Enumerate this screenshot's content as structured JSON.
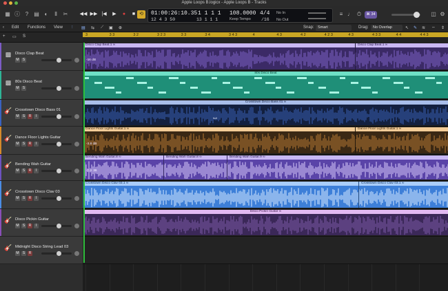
{
  "window": {
    "title": "Apple Loops B.logicx - Apple Loops B - Tracks"
  },
  "lcd": {
    "time": "01:00:26:10.35",
    "position": "12  4  3  50",
    "bars": "1  1  1  1",
    "bars2": "13  1  1  1",
    "tempo": "108.0000",
    "tempo_mode": "Keep Tempo",
    "signature": "4/4",
    "division": "/16",
    "midi_in": "No In",
    "midi_out": "No Out"
  },
  "badge": "⌘ 34",
  "toolbar": {
    "edit": "Edit",
    "functions": "Functions",
    "view": "View",
    "snap_label": "Snap:",
    "snap_value": "Smart",
    "drag_label": "Drag:",
    "drag_value": "No Overlap"
  },
  "ruler": {
    "numbers": [
      "3",
      "3 3",
      "3 2",
      "3 2 3",
      "3 3",
      "3 4",
      "3 4 3",
      "4",
      "4 3",
      "4 2",
      "4 2 3",
      "4 3",
      "4 3 3",
      "4 4",
      "4 4 3"
    ]
  },
  "tracks": [
    {
      "name": "Disco Clap Beat",
      "color": "#7d5cc6",
      "buttons": [
        "M",
        "S"
      ],
      "region_title": "Disco Clap Beat.1",
      "region_title_2": "Disco Clap Beat.1",
      "label": "-16 dB"
    },
    {
      "name": "80s Disco Beat",
      "color": "#2fb596",
      "buttons": [
        "M",
        "S"
      ],
      "region_title": "80s Disco Beat"
    },
    {
      "name": "Crosstown Disco Bass 01",
      "color": "#3a62c0",
      "buttons": [
        "M",
        "S",
        "R",
        "I"
      ],
      "region_title": "Crosstown Disco Bass 01"
    },
    {
      "name": "Dance Floor Lights Guitar",
      "color": "#d68a2a",
      "buttons": [
        "M",
        "S",
        "R",
        "I"
      ],
      "region_title": "Dance Floor Lights Guitar.1",
      "region_title_2": "Dance Floor Lights Guitar.1",
      "label": "-3.8 dB"
    },
    {
      "name": "Bending Wah Guitar",
      "color": "#6d52c0",
      "buttons": [
        "M",
        "S",
        "R",
        "I"
      ],
      "region_title": "Bending Wah Guitar.8",
      "region_title_2": "Bending Wah Guitar.8",
      "region_title_3": "Bending Wah Guitar.9",
      "label": "-0.2 dB"
    },
    {
      "name": "Crosstown Disco Clav 03",
      "color": "#4a8de6",
      "buttons": [
        "M",
        "S",
        "R",
        "I"
      ],
      "region_title": "Crosstown Disco Clav 03.1",
      "region_title_2": "Crosstown Disco Clav 03.1"
    },
    {
      "name": "Disco Pickin Guitar",
      "color": "#8a4fb8",
      "buttons": [
        "M",
        "S",
        "R",
        "I"
      ],
      "region_title": "Disco Pickin Guitar"
    },
    {
      "name": "Midnight Disco String Lead 03",
      "color": "#3a3a3a",
      "buttons": [
        "M",
        "S",
        "R"
      ]
    }
  ]
}
